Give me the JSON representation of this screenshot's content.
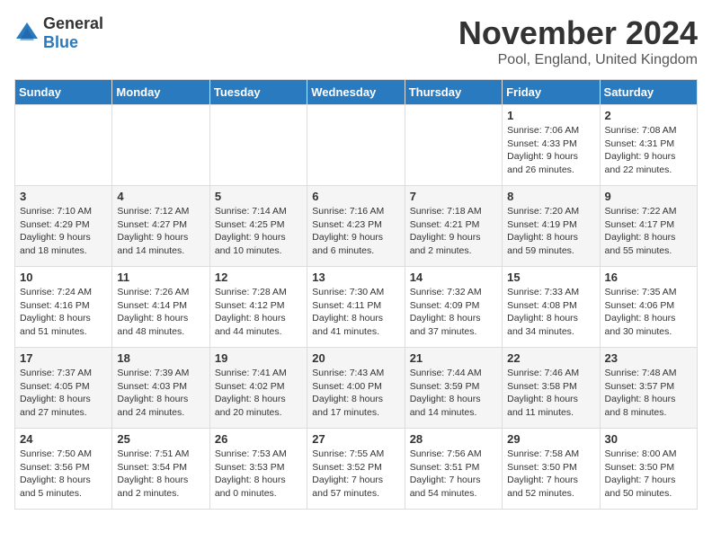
{
  "logo": {
    "text_general": "General",
    "text_blue": "Blue"
  },
  "title": "November 2024",
  "location": "Pool, England, United Kingdom",
  "days_of_week": [
    "Sunday",
    "Monday",
    "Tuesday",
    "Wednesday",
    "Thursday",
    "Friday",
    "Saturday"
  ],
  "weeks": [
    [
      {
        "day": "",
        "info": ""
      },
      {
        "day": "",
        "info": ""
      },
      {
        "day": "",
        "info": ""
      },
      {
        "day": "",
        "info": ""
      },
      {
        "day": "",
        "info": ""
      },
      {
        "day": "1",
        "info": "Sunrise: 7:06 AM\nSunset: 4:33 PM\nDaylight: 9 hours and 26 minutes."
      },
      {
        "day": "2",
        "info": "Sunrise: 7:08 AM\nSunset: 4:31 PM\nDaylight: 9 hours and 22 minutes."
      }
    ],
    [
      {
        "day": "3",
        "info": "Sunrise: 7:10 AM\nSunset: 4:29 PM\nDaylight: 9 hours and 18 minutes."
      },
      {
        "day": "4",
        "info": "Sunrise: 7:12 AM\nSunset: 4:27 PM\nDaylight: 9 hours and 14 minutes."
      },
      {
        "day": "5",
        "info": "Sunrise: 7:14 AM\nSunset: 4:25 PM\nDaylight: 9 hours and 10 minutes."
      },
      {
        "day": "6",
        "info": "Sunrise: 7:16 AM\nSunset: 4:23 PM\nDaylight: 9 hours and 6 minutes."
      },
      {
        "day": "7",
        "info": "Sunrise: 7:18 AM\nSunset: 4:21 PM\nDaylight: 9 hours and 2 minutes."
      },
      {
        "day": "8",
        "info": "Sunrise: 7:20 AM\nSunset: 4:19 PM\nDaylight: 8 hours and 59 minutes."
      },
      {
        "day": "9",
        "info": "Sunrise: 7:22 AM\nSunset: 4:17 PM\nDaylight: 8 hours and 55 minutes."
      }
    ],
    [
      {
        "day": "10",
        "info": "Sunrise: 7:24 AM\nSunset: 4:16 PM\nDaylight: 8 hours and 51 minutes."
      },
      {
        "day": "11",
        "info": "Sunrise: 7:26 AM\nSunset: 4:14 PM\nDaylight: 8 hours and 48 minutes."
      },
      {
        "day": "12",
        "info": "Sunrise: 7:28 AM\nSunset: 4:12 PM\nDaylight: 8 hours and 44 minutes."
      },
      {
        "day": "13",
        "info": "Sunrise: 7:30 AM\nSunset: 4:11 PM\nDaylight: 8 hours and 41 minutes."
      },
      {
        "day": "14",
        "info": "Sunrise: 7:32 AM\nSunset: 4:09 PM\nDaylight: 8 hours and 37 minutes."
      },
      {
        "day": "15",
        "info": "Sunrise: 7:33 AM\nSunset: 4:08 PM\nDaylight: 8 hours and 34 minutes."
      },
      {
        "day": "16",
        "info": "Sunrise: 7:35 AM\nSunset: 4:06 PM\nDaylight: 8 hours and 30 minutes."
      }
    ],
    [
      {
        "day": "17",
        "info": "Sunrise: 7:37 AM\nSunset: 4:05 PM\nDaylight: 8 hours and 27 minutes."
      },
      {
        "day": "18",
        "info": "Sunrise: 7:39 AM\nSunset: 4:03 PM\nDaylight: 8 hours and 24 minutes."
      },
      {
        "day": "19",
        "info": "Sunrise: 7:41 AM\nSunset: 4:02 PM\nDaylight: 8 hours and 20 minutes."
      },
      {
        "day": "20",
        "info": "Sunrise: 7:43 AM\nSunset: 4:00 PM\nDaylight: 8 hours and 17 minutes."
      },
      {
        "day": "21",
        "info": "Sunrise: 7:44 AM\nSunset: 3:59 PM\nDaylight: 8 hours and 14 minutes."
      },
      {
        "day": "22",
        "info": "Sunrise: 7:46 AM\nSunset: 3:58 PM\nDaylight: 8 hours and 11 minutes."
      },
      {
        "day": "23",
        "info": "Sunrise: 7:48 AM\nSunset: 3:57 PM\nDaylight: 8 hours and 8 minutes."
      }
    ],
    [
      {
        "day": "24",
        "info": "Sunrise: 7:50 AM\nSunset: 3:56 PM\nDaylight: 8 hours and 5 minutes."
      },
      {
        "day": "25",
        "info": "Sunrise: 7:51 AM\nSunset: 3:54 PM\nDaylight: 8 hours and 2 minutes."
      },
      {
        "day": "26",
        "info": "Sunrise: 7:53 AM\nSunset: 3:53 PM\nDaylight: 8 hours and 0 minutes."
      },
      {
        "day": "27",
        "info": "Sunrise: 7:55 AM\nSunset: 3:52 PM\nDaylight: 7 hours and 57 minutes."
      },
      {
        "day": "28",
        "info": "Sunrise: 7:56 AM\nSunset: 3:51 PM\nDaylight: 7 hours and 54 minutes."
      },
      {
        "day": "29",
        "info": "Sunrise: 7:58 AM\nSunset: 3:50 PM\nDaylight: 7 hours and 52 minutes."
      },
      {
        "day": "30",
        "info": "Sunrise: 8:00 AM\nSunset: 3:50 PM\nDaylight: 7 hours and 50 minutes."
      }
    ]
  ]
}
